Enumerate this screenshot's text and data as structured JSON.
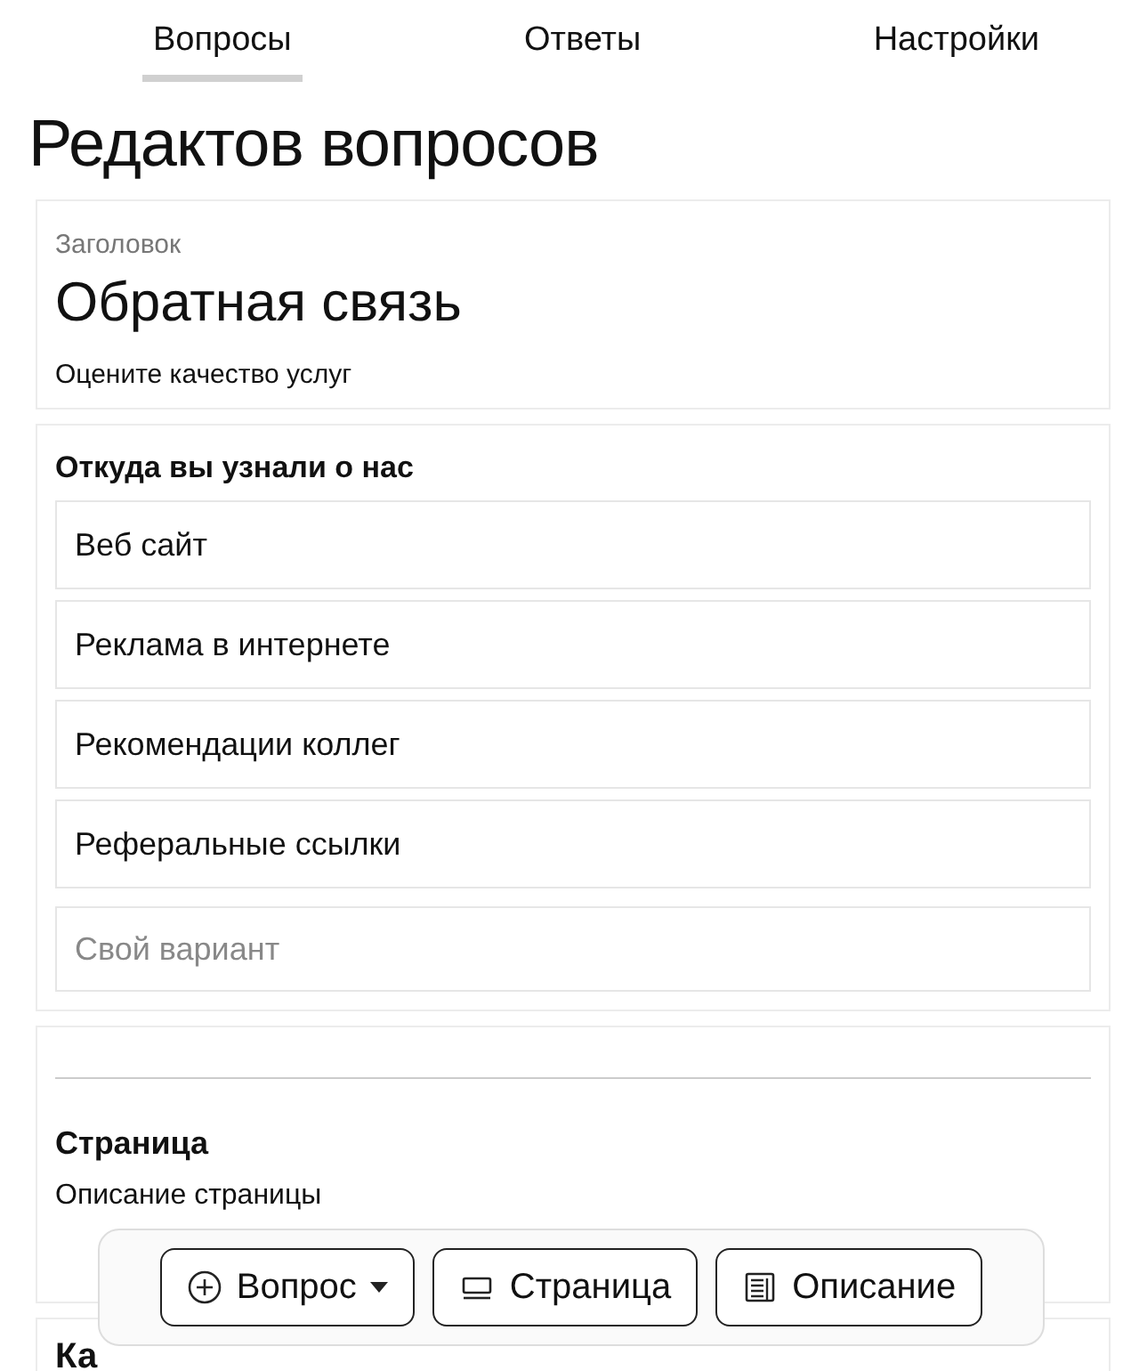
{
  "tabs": [
    {
      "label": "Вопросы",
      "selected": true
    },
    {
      "label": "Ответы",
      "selected": false
    },
    {
      "label": "Настройки",
      "selected": false
    }
  ],
  "page_title": "Редактов вопросов",
  "header_card": {
    "label": "Заголовок",
    "title": "Обратная связь",
    "description": "Оцените качество услуг"
  },
  "question": {
    "title": "Откуда вы узнали о нас",
    "options": [
      {
        "kind": "option",
        "text": "Веб сайт"
      },
      {
        "kind": "option",
        "text": "Реклама в интернете"
      },
      {
        "kind": "option",
        "text": "Рекомендации коллег"
      },
      {
        "kind": "option",
        "text": "Реферальные ссылки"
      },
      {
        "kind": "other",
        "placeholder": "Свой вариант"
      }
    ]
  },
  "page_break": {
    "title": "Страница",
    "description": "Описание страницы"
  },
  "next_question": {
    "title": "Ка"
  },
  "toolbar": [
    {
      "kind": "question",
      "label": "Вопрос",
      "dropdown": true
    },
    {
      "kind": "page",
      "label": "Страница",
      "dropdown": false
    },
    {
      "kind": "description",
      "label": "Описание",
      "dropdown": false
    }
  ]
}
